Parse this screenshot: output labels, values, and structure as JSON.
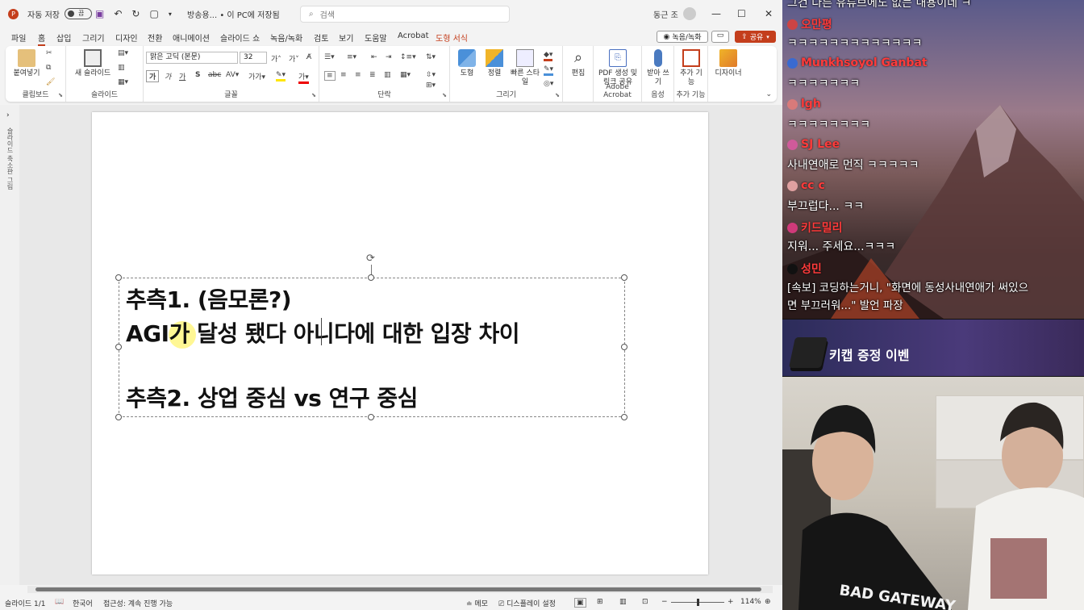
{
  "titlebar": {
    "autosave_label": "자동 저장",
    "autosave_state": "끔",
    "doc_title": "방송용... • 이 PC에 저장됨",
    "search_placeholder": "검색",
    "user_name": "동근 조"
  },
  "menu": {
    "tabs": [
      "파일",
      "홈",
      "삽입",
      "그리기",
      "디자인",
      "전환",
      "애니메이션",
      "슬라이드 쇼",
      "녹음/녹화",
      "검토",
      "보기",
      "도움말",
      "Acrobat"
    ],
    "context_tab": "도형 서식",
    "record_btn": "녹음/녹화",
    "share_btn": "공유"
  },
  "ribbon": {
    "clipboard": {
      "paste": "붙여넣기",
      "label": "클립보드"
    },
    "slides": {
      "new_slide": "새 슬라이드",
      "label": "슬라이드"
    },
    "font": {
      "font_name": "맑은 고딕 (본문)",
      "font_size": "32",
      "label": "글꼴"
    },
    "paragraph": {
      "label": "단락"
    },
    "drawing": {
      "shape": "도형",
      "arrange": "정렬",
      "quick_styles": "빠른 스타일",
      "label": "그리기"
    },
    "editing": {
      "edit": "편집"
    },
    "acrobat": {
      "pdf": "PDF 생성 및 링크 공유",
      "label": "Adobe Acrobat"
    },
    "voice": {
      "dictate": "받아 쓰기",
      "label": "음성"
    },
    "addins": {
      "addins": "추가 기능",
      "label": "추가 기능"
    },
    "designer": {
      "designer": "디자이너"
    }
  },
  "slide": {
    "lines": [
      "추측1. (음모론?)",
      "AGI가 달성 됐다 아니다에 대한 입장 차이",
      "",
      "추측2. 상업 중심 vs 연구 중심"
    ]
  },
  "thumbpane": {
    "label": "슬라이드 축소판 그림"
  },
  "status": {
    "slide_num": "슬라이드 1/1",
    "lang": "한국어",
    "accessibility": "접근성: 계속 진행 가능",
    "notes": "메모",
    "display": "디스플레이 설정",
    "zoom": "114%"
  },
  "chat": [
    {
      "name": "",
      "msg": "그건 다른 유튜브에도 없는 내용이네 ㅋ"
    },
    {
      "name": "오만평",
      "msg": "ㅋㅋㅋㅋㅋㅋㅋㅋㅋㅋㅋㅋㅋ"
    },
    {
      "name": "Munkhsoyol Ganbat",
      "msg": "ㅋㅋㅋㅋㅋㅋㅋ"
    },
    {
      "name": "lgh",
      "msg": "ㅋㅋㅋㅋㅋㅋㅋㅋ"
    },
    {
      "name": "SJ Lee",
      "msg": "사내연애로 먼직 ㅋㅋㅋㅋㅋ"
    },
    {
      "name": "cc c",
      "msg": "부끄럽다... ㅋㅋ"
    },
    {
      "name": "키드밀리",
      "msg": "지워... 주세요...ㅋㅋㅋ"
    },
    {
      "name": "성민",
      "msg": "[속보] 코딩하는거니, \"화면에 동성사내연애가 써있으",
      "msg2": "면 부끄러워...\" 발언 파장"
    }
  ],
  "banner": {
    "text": "키캡 증정 이벤"
  },
  "colors": {
    "accent": "#c43e1c",
    "chat_name": "#ff3b3b"
  }
}
